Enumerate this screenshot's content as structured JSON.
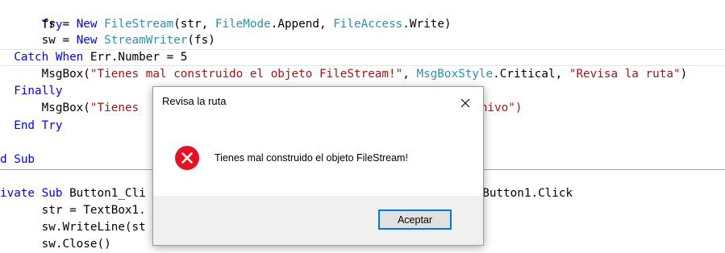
{
  "code": {
    "lines": [
      {
        "t0": "  Try"
      },
      {
        "t0": "      fs = ",
        "t1": "New",
        "t2": " ",
        "t3": "FileStream",
        "t4": "(str, ",
        "t5": "FileMode",
        "t6": ".Append, ",
        "t7": "FileAccess",
        "t8": ".Write)"
      },
      {
        "t0": "      sw = ",
        "t1": "New",
        "t2": " ",
        "t3": "StreamWriter",
        "t4": "(fs)"
      },
      {
        "t0": "  Catch When",
        "t1": " Err.Number = 5"
      },
      {
        "t0": "      MsgBox(",
        "t1": "\"Tienes mal construido el objeto FileStream!\"",
        "t2": ", ",
        "t3": "MsgBoxStyle",
        "t4": ".Critical, ",
        "t5": "\"Revisa la ruta\"",
        "t6": ")"
      },
      {
        "t0": "  Finally"
      },
      {
        "t0": "      MsgBox(",
        "t1": "\"Tienes",
        "t2": "archivo\")"
      },
      {
        "t0": "  End Try"
      },
      {
        "t0": "d Sub"
      },
      {
        "t0": "ivate Sub",
        "t1": " Button1_Cli",
        "t2": "s",
        "t3": " Button1.Click"
      },
      {
        "t0": "      str = TextBox1."
      },
      {
        "t0": "      sw.WriteLine(st"
      },
      {
        "t0": "      sw.Close()"
      }
    ]
  },
  "dialog": {
    "title": "Revisa la ruta",
    "message": "Tienes mal construido el objeto FileStream!",
    "ok_label": "Aceptar",
    "icon": "error-icon",
    "close_icon": "close-icon"
  },
  "colors": {
    "keyword": "#0000ff",
    "type": "#2b91af",
    "string": "#a31515",
    "error_red": "#e81123",
    "button_focus": "#0078d7"
  }
}
